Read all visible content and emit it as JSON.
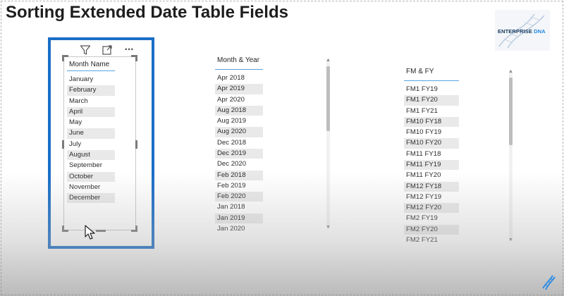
{
  "page": {
    "title": "Sorting Extended Date Table Fields"
  },
  "logo": {
    "text_main": "ENTERPRISE",
    "text_accent": "DNA"
  },
  "visual_header": {
    "icons": [
      "filter-icon",
      "focus-mode-icon",
      "more-options-icon"
    ],
    "more_glyph": "···"
  },
  "slicers": [
    {
      "field": "Month Name",
      "items": [
        "January",
        "February",
        "March",
        "April",
        "May",
        "June",
        "July",
        "August",
        "September",
        "October",
        "November",
        "December"
      ]
    },
    {
      "field": "Month & Year",
      "items": [
        "Apr 2018",
        "Apr 2019",
        "Apr 2020",
        "Aug 2018",
        "Aug 2019",
        "Aug 2020",
        "Dec 2018",
        "Dec 2019",
        "Dec 2020",
        "Feb 2018",
        "Feb 2019",
        "Feb 2020",
        "Jan 2018",
        "Jan 2019",
        "Jan 2020"
      ]
    },
    {
      "field": "FM & FY",
      "items": [
        "FM1 FY19",
        "FM1 FY20",
        "FM1 FY21",
        "FM10 FY18",
        "FM10 FY19",
        "FM10 FY20",
        "FM11 FY18",
        "FM11 FY19",
        "FM11 FY20",
        "FM12 FY18",
        "FM12 FY19",
        "FM12 FY20",
        "FM2 FY19",
        "FM2 FY20",
        "FM2 FY21"
      ]
    }
  ],
  "colors": {
    "selection_border": "#1a6ec7",
    "header_underline": "#58a3e0",
    "shaded_item": "#e9e9e9",
    "logo_dark": "#143a5e",
    "logo_accent": "#1e88e5"
  },
  "scroll_glyphs": {
    "up": "▲",
    "down": "▼"
  }
}
